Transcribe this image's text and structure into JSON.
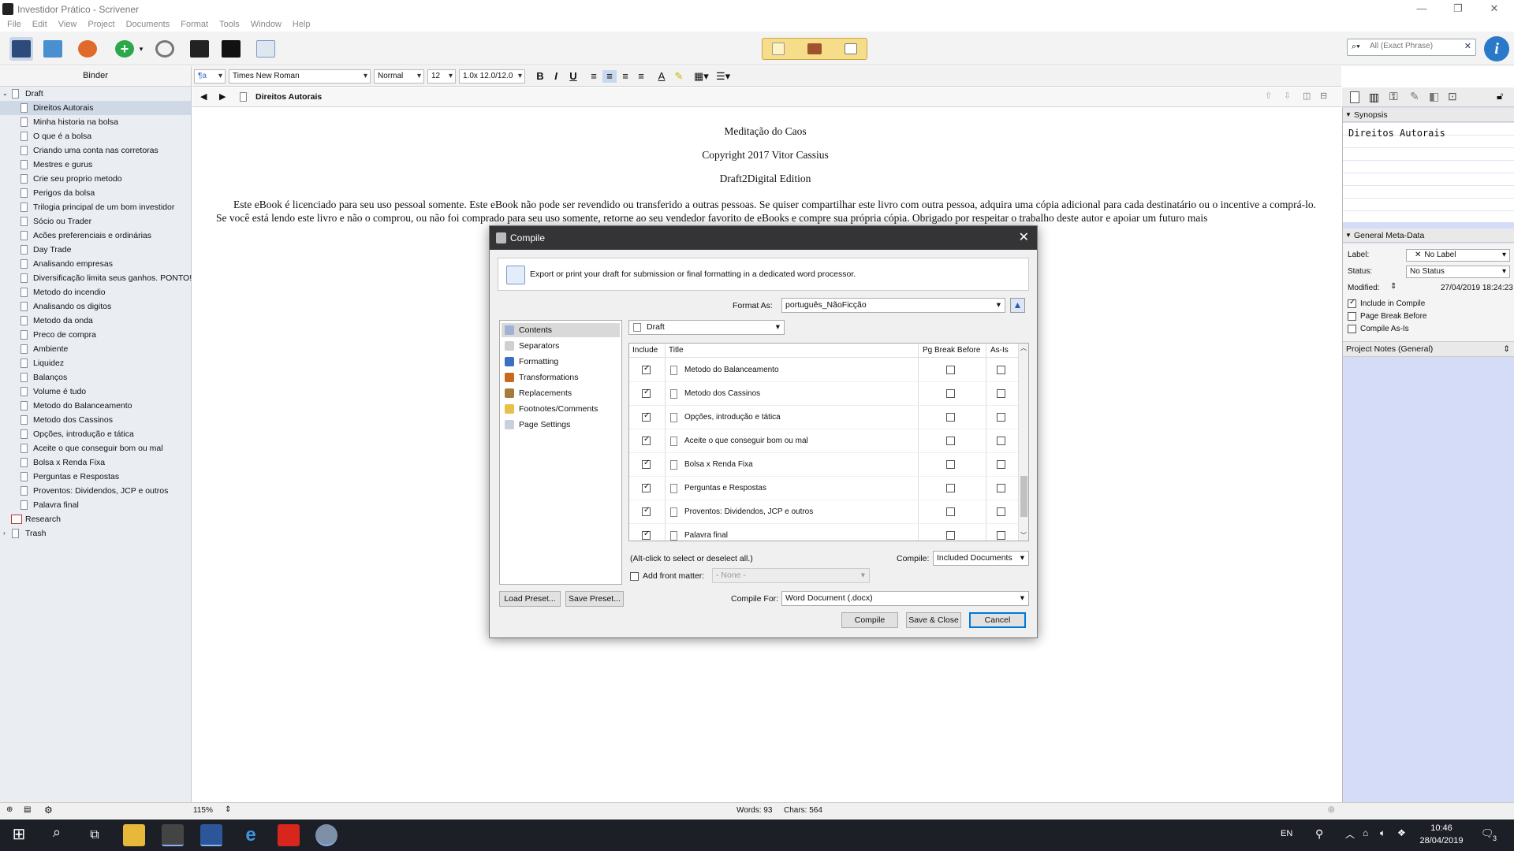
{
  "window": {
    "title": "Investidor Prático - Scrivener"
  },
  "menu": [
    "File",
    "Edit",
    "View",
    "Project",
    "Documents",
    "Format",
    "Tools",
    "Window",
    "Help"
  ],
  "search": {
    "placeholder": "All (Exact Phrase)"
  },
  "binder": {
    "header": "Binder",
    "root": "Draft",
    "items": [
      "Direitos Autorais",
      "Minha historia na bolsa",
      "O que é a bolsa",
      "Criando uma conta nas corretoras",
      "Mestres e gurus",
      "Crie seu proprio metodo",
      "Perigos da bolsa",
      "Trilogia principal de um bom investidor",
      "Sócio ou Trader",
      "Acões preferenciais e ordinárias",
      "Day Trade",
      "Analisando empresas",
      "Diversificação limita seus ganhos. PONTO!",
      "Metodo do incendio",
      "Analisando os digitos",
      "Metodo da onda",
      "Preco de compra",
      "Ambiente",
      "Liquidez",
      "Balanços",
      "Volume é tudo",
      "Metodo do Balanceamento",
      "Metodo dos Cassinos",
      "Opções, introdução e tática",
      "Aceite o que conseguir bom ou mal",
      "Bolsa x Renda Fixa",
      "Perguntas e Respostas",
      "Proventos: Dividendos, JCP e outros",
      "Palavra final"
    ],
    "research": "Research",
    "trash": "Trash"
  },
  "format_bar": {
    "font": "Times New Roman",
    "style": "Normal",
    "size": "12",
    "spacing": "1.0x 12.0/12.0",
    "bold": "B",
    "italic": "I",
    "underline": "U"
  },
  "editor": {
    "doc_title": "Direitos Autorais",
    "line1": "Meditação do Caos",
    "line2": "Copyright 2017 Vitor Cassius",
    "line3": "Draft2Digital Edition",
    "para": "Este eBook é licenciado para seu uso pessoal somente. Este eBook não pode ser revendido ou transferido a outras pessoas. Se quiser compartilhar este livro com outra pessoa, adquira uma cópia adicional para cada destinatário ou o incentive a comprá-lo. Se você está lendo este livro e não o comprou, ou não foi comprado para seu uso somente, retorne ao seu vendedor favorito de eBooks e compre sua própria cópia. Obrigado por respeitar o trabalho deste autor e apoiar um futuro mais"
  },
  "inspector": {
    "synopsis_header": "Synopsis",
    "synopsis_text": "Direitos Autorais",
    "meta_header": "General Meta-Data",
    "label_label": "Label:",
    "label_value": "No Label",
    "status_label": "Status:",
    "status_value": "No Status",
    "modified_label": "Modified:",
    "modified_value": "27/04/2019 18:24:23",
    "include_compile": "Include in Compile",
    "page_break": "Page Break Before",
    "compile_as_is": "Compile As-Is",
    "notes_header": "Project Notes (General)"
  },
  "status": {
    "zoom": "115%",
    "words": "Words: 93",
    "chars": "Chars: 564"
  },
  "taskbar": {
    "lang": "EN",
    "time": "10:46",
    "date": "28/04/2019",
    "notif": "3"
  },
  "dialog": {
    "title": "Compile",
    "banner": "Export or print your draft for submission or final formatting in a dedicated word processor.",
    "format_as_label": "Format As:",
    "format_as_value": "português_NãoFicção",
    "left_items": [
      "Contents",
      "Separators",
      "Formatting",
      "Transformations",
      "Replacements",
      "Footnotes/Comments",
      "Page Settings"
    ],
    "folder": "Draft",
    "columns": {
      "include": "Include",
      "title": "Title",
      "pg_break": "Pg Break Before",
      "as_is": "As-Is"
    },
    "rows": [
      {
        "title": "Metodo do Balanceamento"
      },
      {
        "title": "Metodo dos Cassinos"
      },
      {
        "title": "Opções, introdução e tática"
      },
      {
        "title": "Aceite o que conseguir bom ou mal"
      },
      {
        "title": "Bolsa x Renda Fixa"
      },
      {
        "title": "Perguntas e Respostas"
      },
      {
        "title": "Proventos: Dividendos, JCP e outros"
      },
      {
        "title": "Palavra final"
      }
    ],
    "alt_click_hint": "(Alt-click to select or deselect all.)",
    "compile_label": "Compile:",
    "compile_value": "Included Documents",
    "front_matter_label": "Add front matter:",
    "front_matter_value": "- None -",
    "load_preset": "Load Preset...",
    "save_preset": "Save Preset...",
    "compile_for_label": "Compile For:",
    "compile_for_value": "Word Document (.docx)",
    "btn_compile": "Compile",
    "btn_save_close": "Save & Close",
    "btn_cancel": "Cancel"
  }
}
